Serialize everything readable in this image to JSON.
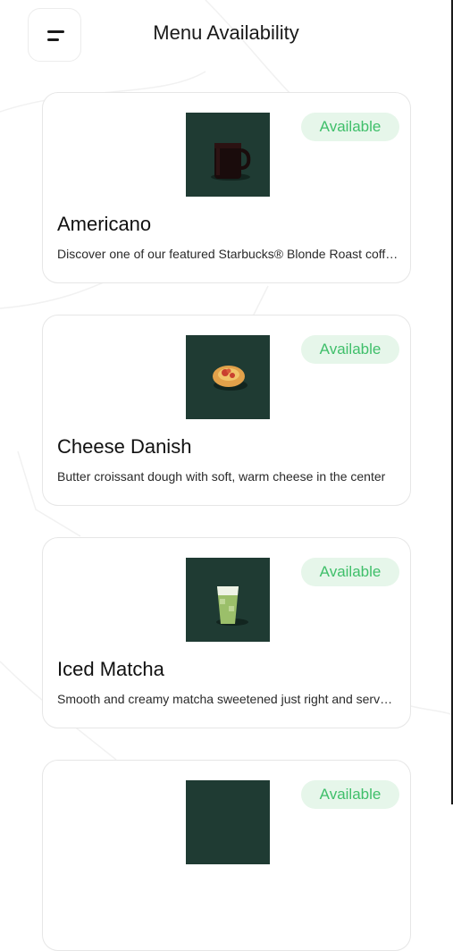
{
  "header": {
    "title": "Menu Availability",
    "menu_icon": "hamburger-menu-icon"
  },
  "items": [
    {
      "name": "Americano",
      "description": "Discover one of our featured Starbucks® Blonde Roast coffees",
      "status": "Available",
      "image_icon": "coffee-mug-icon"
    },
    {
      "name": "Cheese Danish",
      "description": "Butter croissant dough with soft, warm cheese in the center",
      "status": "Available",
      "image_icon": "pastry-icon"
    },
    {
      "name": "Iced Matcha",
      "description": "Smooth and creamy matcha sweetened just right and served over ice",
      "status": "Available",
      "image_icon": "iced-drink-icon"
    },
    {
      "name": "",
      "description": "",
      "status": "Available",
      "image_icon": "product-image-icon"
    }
  ],
  "colors": {
    "badge_bg": "#e6f6ea",
    "badge_text": "#3fbf6a",
    "thumb_bg": "#1f3b33"
  }
}
